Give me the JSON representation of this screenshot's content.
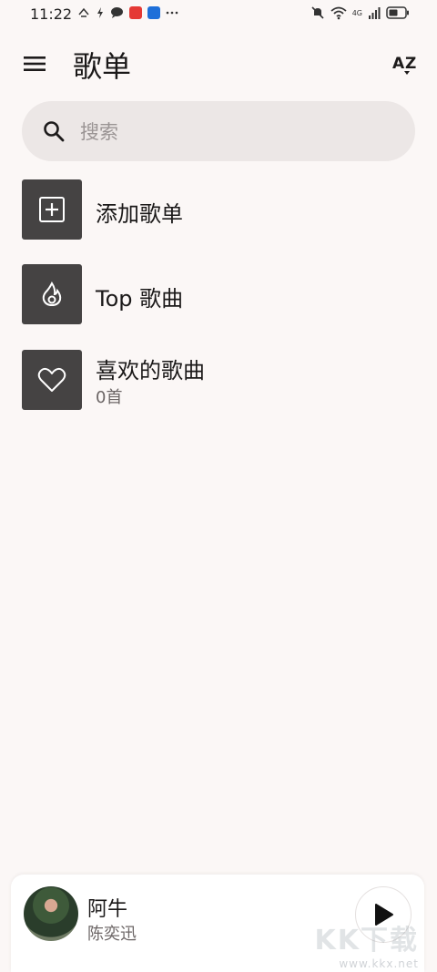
{
  "status_bar": {
    "time": "11:22",
    "network": "4G"
  },
  "header": {
    "title": "歌单",
    "menu_icon": "menu-icon",
    "sort_icon": "sort-az-icon"
  },
  "search": {
    "placeholder": "搜索",
    "value": ""
  },
  "playlists": [
    {
      "title": "添加歌单",
      "subtitle": "",
      "icon": "add-box-icon"
    },
    {
      "title": "Top 歌曲",
      "subtitle": "",
      "icon": "flame-icon"
    },
    {
      "title": "喜欢的歌曲",
      "subtitle": "0首",
      "icon": "heart-icon"
    }
  ],
  "now_playing": {
    "title": "阿牛",
    "artist": "陈奕迅"
  },
  "watermark": {
    "big": "KK下载",
    "small": "www.kkx.net"
  },
  "colors": {
    "background": "#fbf7f6",
    "tile": "#454343",
    "search_bg": "#ece7e6"
  }
}
